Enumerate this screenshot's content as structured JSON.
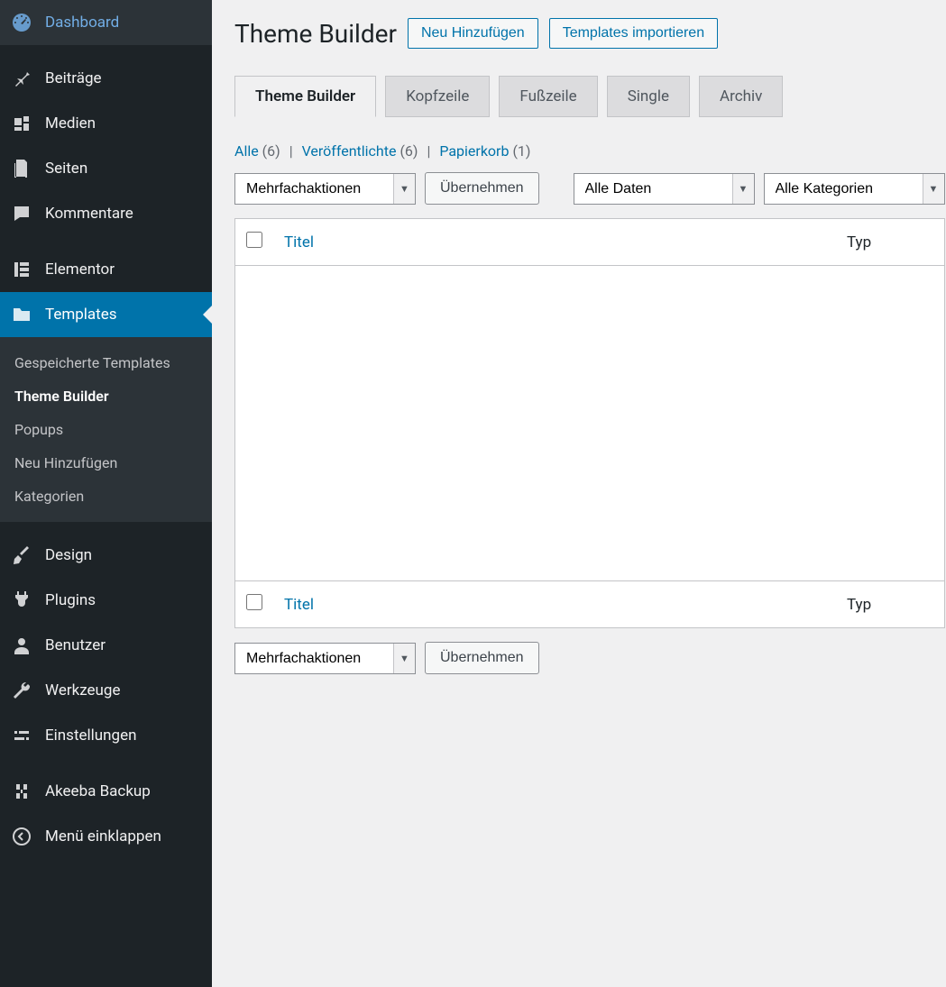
{
  "sidebar": {
    "items": [
      {
        "label": "Dashboard",
        "icon": "dashboard"
      },
      {
        "label": "Beiträge",
        "icon": "pin"
      },
      {
        "label": "Medien",
        "icon": "media"
      },
      {
        "label": "Seiten",
        "icon": "page"
      },
      {
        "label": "Kommentare",
        "icon": "comment"
      },
      {
        "label": "Elementor",
        "icon": "elementor"
      },
      {
        "label": "Templates",
        "icon": "folder",
        "active": true
      },
      {
        "label": "Design",
        "icon": "brush"
      },
      {
        "label": "Plugins",
        "icon": "plug"
      },
      {
        "label": "Benutzer",
        "icon": "user"
      },
      {
        "label": "Werkzeuge",
        "icon": "wrench"
      },
      {
        "label": "Einstellungen",
        "icon": "settings"
      },
      {
        "label": "Akeeba Backup",
        "icon": "akeeba"
      },
      {
        "label": "Menü einklappen",
        "icon": "collapse"
      }
    ],
    "submenu": [
      {
        "label": "Gespeicherte Templates"
      },
      {
        "label": "Theme Builder",
        "current": true
      },
      {
        "label": "Popups"
      },
      {
        "label": "Neu Hinzufügen"
      },
      {
        "label": "Kategorien"
      }
    ]
  },
  "header": {
    "title": "Theme Builder",
    "add_new": "Neu Hinzufügen",
    "import": "Templates importieren"
  },
  "tabs": [
    {
      "label": "Theme Builder",
      "active": true
    },
    {
      "label": "Kopfzeile"
    },
    {
      "label": "Fußzeile"
    },
    {
      "label": "Single"
    },
    {
      "label": "Archiv"
    }
  ],
  "filters": {
    "all_label": "Alle",
    "all_count": "(6)",
    "published_label": "Veröffentlichte",
    "published_count": "(6)",
    "trash_label": "Papierkorb",
    "trash_count": "(1)"
  },
  "bulk": {
    "actions_label": "Mehrfachaktionen",
    "apply": "Übernehmen",
    "dates_label": "Alle Daten",
    "categories_label": "Alle Kategorien"
  },
  "table": {
    "title_header": "Titel",
    "type_header": "Typ"
  }
}
